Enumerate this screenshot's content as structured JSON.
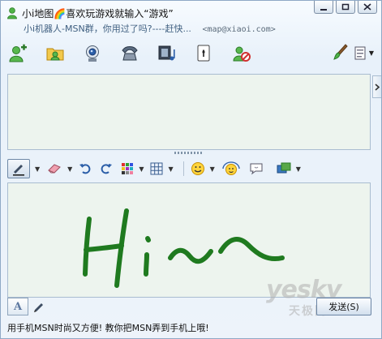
{
  "window": {
    "title": "小i地图🌈喜欢玩游戏就输入“游戏”",
    "subtitle": "小i机器人-MSN群，你用过了吗?----赶快...",
    "contact_email": "<map@xiaoi.com>"
  },
  "window_controls": [
    "minimize-icon",
    "maximize-icon",
    "close-icon"
  ],
  "toolbar": {
    "items": [
      {
        "name": "invite-contact",
        "icon": "add-user-icon"
      },
      {
        "name": "send-files",
        "icon": "folder-share-icon"
      },
      {
        "name": "video-call",
        "icon": "webcam-icon"
      },
      {
        "name": "voice-call",
        "icon": "phone-icon"
      },
      {
        "name": "activities",
        "icon": "film-music-icon"
      },
      {
        "name": "games",
        "icon": "games-icon"
      },
      {
        "name": "block",
        "icon": "block-user-icon"
      }
    ],
    "right_items": [
      {
        "name": "background",
        "icon": "brush-icon"
      },
      {
        "name": "more",
        "icon": "menu-icon"
      }
    ]
  },
  "format_toolbar": {
    "items": [
      {
        "name": "pen",
        "icon": "pen-icon",
        "pressed": true
      },
      {
        "name": "eraser",
        "icon": "eraser-icon"
      },
      {
        "name": "undo",
        "icon": "undo-icon"
      },
      {
        "name": "redo",
        "icon": "redo-icon"
      },
      {
        "name": "color",
        "icon": "color-grid-icon"
      },
      {
        "name": "background",
        "icon": "grid-icon"
      },
      {
        "name": "emoticon",
        "icon": "smiley-icon"
      },
      {
        "name": "wink",
        "icon": "wink-icon"
      },
      {
        "name": "nudge",
        "icon": "nudge-icon"
      },
      {
        "name": "voice-clip",
        "icon": "voice-icon"
      }
    ]
  },
  "compose": {
    "ink_text": "Hi~~",
    "ink_color": "#1f7a1f"
  },
  "mode_tabs": [
    {
      "name": "text-mode",
      "label": "A",
      "active": true
    },
    {
      "name": "ink-mode",
      "icon": "pen-icon",
      "active": false
    }
  ],
  "send_button": {
    "label": "发送(S)"
  },
  "watermark": {
    "line1": "yesky",
    "line2": "天极网"
  },
  "footer": {
    "text": "用手机MSN时尚又方便! 教你把MSN弄到手机上哦!"
  }
}
